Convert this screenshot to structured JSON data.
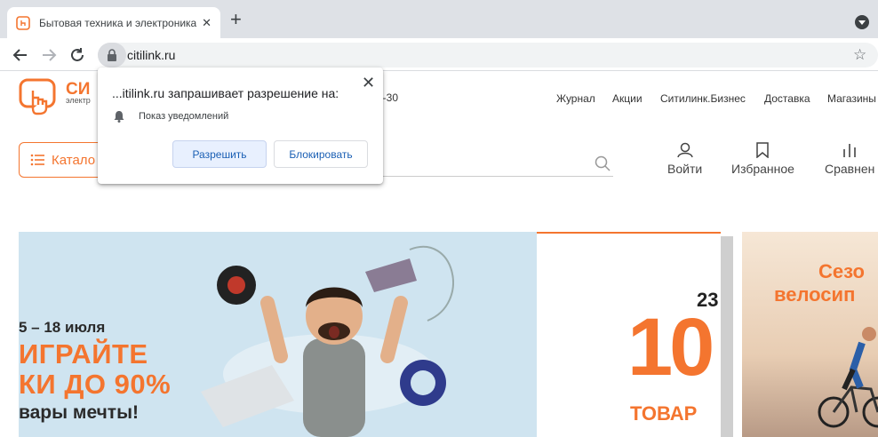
{
  "browser": {
    "tab_title": "Бытовая техника и электроника",
    "tab_close": "✕",
    "new_tab": "+",
    "url": "citilink.ru",
    "bookmark_star": "☆"
  },
  "site": {
    "logo_text": "СИ",
    "logo_sub": "электр",
    "phone": "3-30",
    "nav": [
      "Журнал",
      "Акции",
      "Ситилинк.Бизнес",
      "Доставка",
      "Магазины"
    ],
    "catalog_label": "Катало",
    "actions": [
      {
        "label": "Войти",
        "icon": "user-icon"
      },
      {
        "label": "Избранное",
        "icon": "bookmark-icon"
      },
      {
        "label": "Сравнен",
        "icon": "compare-icon"
      }
    ]
  },
  "banner_main": {
    "date": "5 – 18 июля",
    "headline_1": "ИГРАЙТЕ",
    "headline_2": "КИ ДО 90%",
    "sub": "вары мечты!"
  },
  "banner_right": {
    "number_small": "23",
    "number_big": "10",
    "word": "ТОВАР"
  },
  "banner_second": {
    "line1": "Сезо",
    "line2": "велосип"
  },
  "permission_popup": {
    "title": "...itilink.ru запрашивает разрешение на:",
    "permission": "Показ уведомлений",
    "allow_label": "Разрешить",
    "block_label": "Блокировать",
    "close": "✕"
  },
  "colors": {
    "brand_orange": "#f4752f",
    "banner_blue": "#cfe4f0",
    "allow_bg": "#e8f0fe",
    "link_blue": "#1a5fb4"
  }
}
